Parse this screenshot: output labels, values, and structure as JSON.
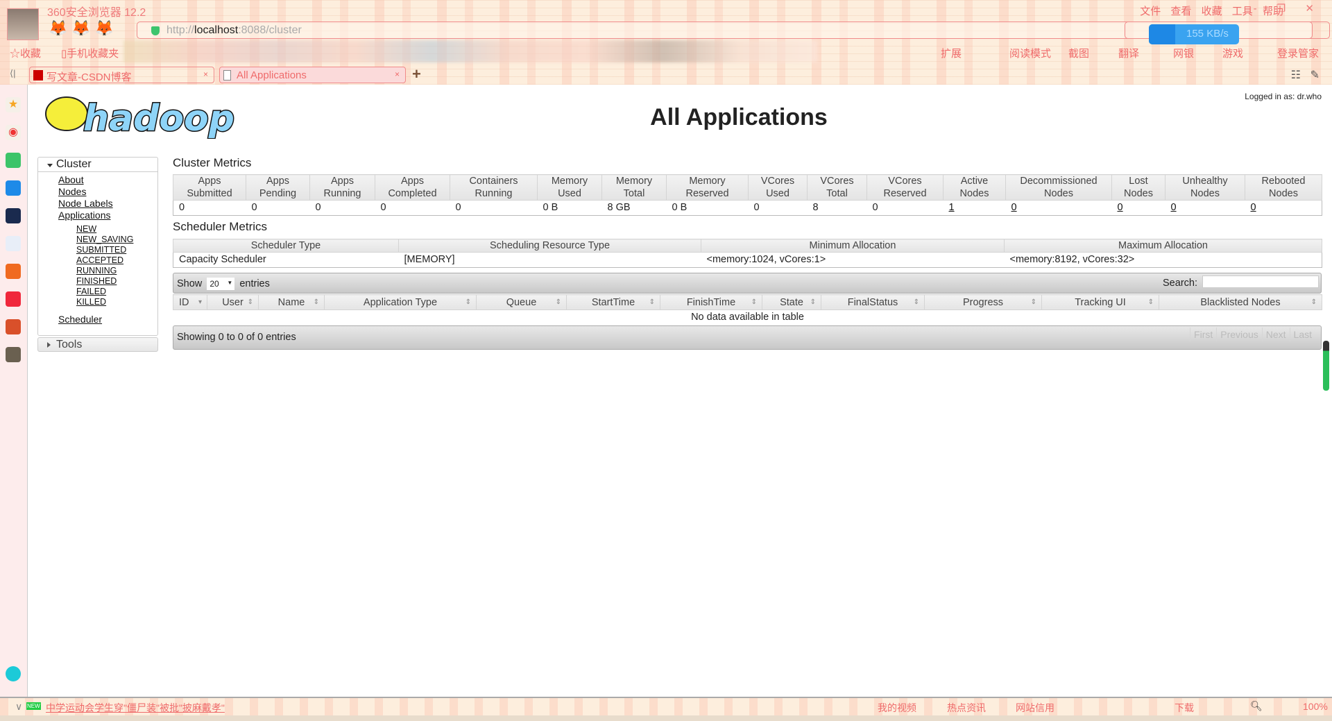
{
  "browser": {
    "app_title": "360安全浏览器 12.2",
    "url_scheme": "http://",
    "url_host": "localhost",
    "url_rest": ":8088/cluster",
    "menu": [
      "文件",
      "查看",
      "收藏",
      "工具",
      "帮助"
    ],
    "download_speed": "155 KB/s",
    "bookmarks": [
      "收藏",
      "手机收藏夹"
    ],
    "toolbar": [
      "扩展",
      "阅读模式",
      "截图",
      "翻译",
      "网银",
      "游戏",
      "登录管家"
    ],
    "tabs": [
      {
        "label": "写文章-CSDN博客",
        "active": false
      },
      {
        "label": "All Applications",
        "active": true
      }
    ],
    "status_news": "中学运动会学生穿\"僵尸装\"被批\"披麻戴孝\"",
    "status_items": [
      "我的视频",
      "热点资讯",
      "网站信用",
      "下载"
    ],
    "zoom": "100%"
  },
  "header": {
    "title": "All Applications",
    "logged_in": "Logged in as: dr.who",
    "logo_text": "hadoop"
  },
  "nav": {
    "cluster_label": "Cluster",
    "items": [
      "About",
      "Nodes",
      "Node Labels",
      "Applications"
    ],
    "app_states": [
      "NEW",
      "NEW_SAVING",
      "SUBMITTED",
      "ACCEPTED",
      "RUNNING",
      "FINISHED",
      "FAILED",
      "KILLED"
    ],
    "scheduler": "Scheduler",
    "tools_label": "Tools"
  },
  "cluster_metrics": {
    "title": "Cluster Metrics",
    "headers": [
      [
        "Apps",
        "Submitted"
      ],
      [
        "Apps",
        "Pending"
      ],
      [
        "Apps",
        "Running"
      ],
      [
        "Apps",
        "Completed"
      ],
      [
        "Containers",
        "Running"
      ],
      [
        "Memory",
        "Used"
      ],
      [
        "Memory",
        "Total"
      ],
      [
        "Memory",
        "Reserved"
      ],
      [
        "VCores",
        "Used"
      ],
      [
        "VCores",
        "Total"
      ],
      [
        "VCores",
        "Reserved"
      ],
      [
        "Active",
        "Nodes"
      ],
      [
        "Decommissioned",
        "Nodes"
      ],
      [
        "Lost",
        "Nodes"
      ],
      [
        "Unhealthy",
        "Nodes"
      ],
      [
        "Rebooted",
        "Nodes"
      ]
    ],
    "values": [
      "0",
      "0",
      "0",
      "0",
      "0",
      "0 B",
      "8 GB",
      "0 B",
      "0",
      "8",
      "0",
      "1",
      "0",
      "0",
      "0",
      "0"
    ]
  },
  "scheduler_metrics": {
    "title": "Scheduler Metrics",
    "headers": [
      "Scheduler Type",
      "Scheduling Resource Type",
      "Minimum Allocation",
      "Maximum Allocation"
    ],
    "values": [
      "Capacity Scheduler",
      "[MEMORY]",
      "<memory:1024, vCores:1>",
      "<memory:8192, vCores:32>"
    ]
  },
  "apps_table": {
    "show_label": "Show",
    "entries_label": "entries",
    "page_size": "20",
    "search_label": "Search:",
    "search_value": "",
    "columns": [
      "ID",
      "User",
      "Name",
      "Application Type",
      "Queue",
      "StartTime",
      "FinishTime",
      "State",
      "FinalStatus",
      "Progress",
      "Tracking UI",
      "Blacklisted Nodes"
    ],
    "empty": "No data available in table",
    "info": "Showing 0 to 0 of 0 entries",
    "pager": [
      "First",
      "Previous",
      "Next",
      "Last"
    ]
  }
}
